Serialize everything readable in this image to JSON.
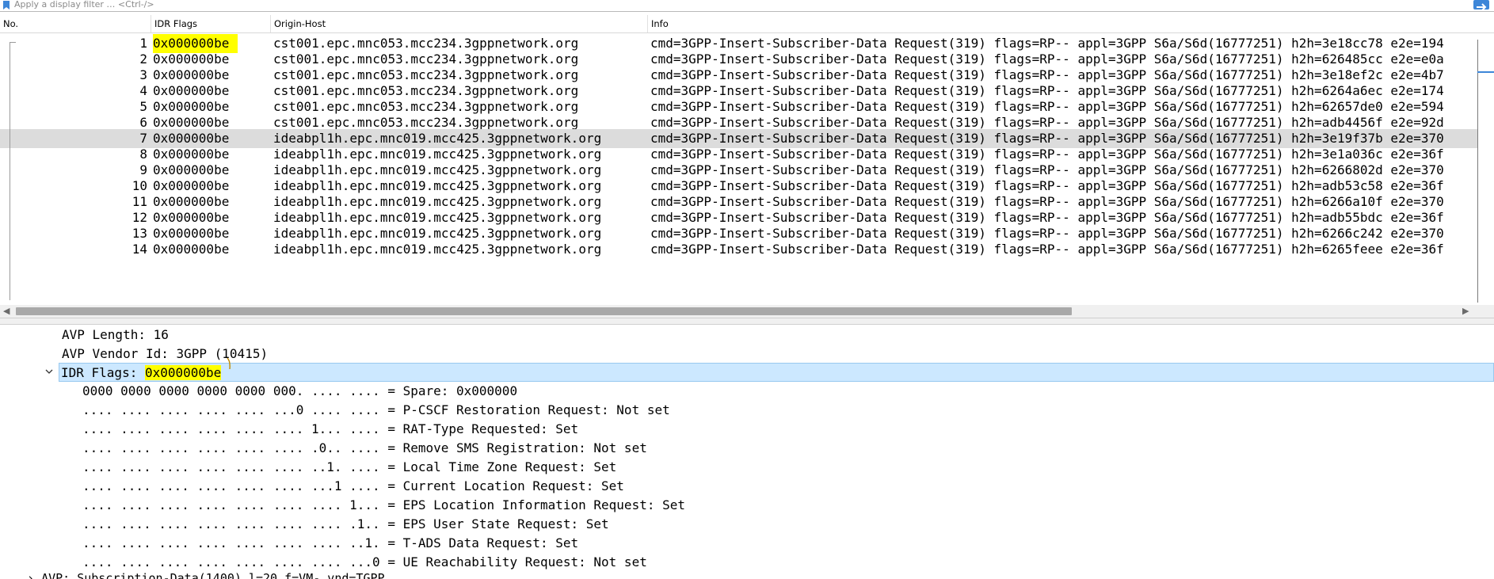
{
  "filter": {
    "placeholder": "Apply a display filter … <Ctrl-/>"
  },
  "columns": [
    "No.",
    "IDR Flags",
    "Origin-Host",
    "Info"
  ],
  "packets": [
    {
      "no": "1",
      "flags": "0x000000be",
      "host": "cst001.epc.mnc053.mcc234.3gppnetwork.org",
      "info": "cmd=3GPP-Insert-Subscriber-Data Request(319) flags=RP-- appl=3GPP S6a/S6d(16777251) h2h=3e18cc78 e2e=194"
    },
    {
      "no": "2",
      "flags": "0x000000be",
      "host": "cst001.epc.mnc053.mcc234.3gppnetwork.org",
      "info": "cmd=3GPP-Insert-Subscriber-Data Request(319) flags=RP-- appl=3GPP S6a/S6d(16777251) h2h=626485cc e2e=e0a"
    },
    {
      "no": "3",
      "flags": "0x000000be",
      "host": "cst001.epc.mnc053.mcc234.3gppnetwork.org",
      "info": "cmd=3GPP-Insert-Subscriber-Data Request(319) flags=RP-- appl=3GPP S6a/S6d(16777251) h2h=3e18ef2c e2e=4b7"
    },
    {
      "no": "4",
      "flags": "0x000000be",
      "host": "cst001.epc.mnc053.mcc234.3gppnetwork.org",
      "info": "cmd=3GPP-Insert-Subscriber-Data Request(319) flags=RP-- appl=3GPP S6a/S6d(16777251) h2h=6264a6ec e2e=174"
    },
    {
      "no": "5",
      "flags": "0x000000be",
      "host": "cst001.epc.mnc053.mcc234.3gppnetwork.org",
      "info": "cmd=3GPP-Insert-Subscriber-Data Request(319) flags=RP-- appl=3GPP S6a/S6d(16777251) h2h=62657de0 e2e=594"
    },
    {
      "no": "6",
      "flags": "0x000000be",
      "host": "cst001.epc.mnc053.mcc234.3gppnetwork.org",
      "info": "cmd=3GPP-Insert-Subscriber-Data Request(319) flags=RP-- appl=3GPP S6a/S6d(16777251) h2h=adb4456f e2e=92d"
    },
    {
      "no": "7",
      "flags": "0x000000be",
      "host": "ideabpl1h.epc.mnc019.mcc425.3gppnetwork.org",
      "info": "cmd=3GPP-Insert-Subscriber-Data Request(319) flags=RP-- appl=3GPP S6a/S6d(16777251) h2h=3e19f37b e2e=370"
    },
    {
      "no": "8",
      "flags": "0x000000be",
      "host": "ideabpl1h.epc.mnc019.mcc425.3gppnetwork.org",
      "info": "cmd=3GPP-Insert-Subscriber-Data Request(319) flags=RP-- appl=3GPP S6a/S6d(16777251) h2h=3e1a036c e2e=36f"
    },
    {
      "no": "9",
      "flags": "0x000000be",
      "host": "ideabpl1h.epc.mnc019.mcc425.3gppnetwork.org",
      "info": "cmd=3GPP-Insert-Subscriber-Data Request(319) flags=RP-- appl=3GPP S6a/S6d(16777251) h2h=6266802d e2e=370"
    },
    {
      "no": "10",
      "flags": "0x000000be",
      "host": "ideabpl1h.epc.mnc019.mcc425.3gppnetwork.org",
      "info": "cmd=3GPP-Insert-Subscriber-Data Request(319) flags=RP-- appl=3GPP S6a/S6d(16777251) h2h=adb53c58 e2e=36f"
    },
    {
      "no": "11",
      "flags": "0x000000be",
      "host": "ideabpl1h.epc.mnc019.mcc425.3gppnetwork.org",
      "info": "cmd=3GPP-Insert-Subscriber-Data Request(319) flags=RP-- appl=3GPP S6a/S6d(16777251) h2h=6266a10f e2e=370"
    },
    {
      "no": "12",
      "flags": "0x000000be",
      "host": "ideabpl1h.epc.mnc019.mcc425.3gppnetwork.org",
      "info": "cmd=3GPP-Insert-Subscriber-Data Request(319) flags=RP-- appl=3GPP S6a/S6d(16777251) h2h=adb55bdc e2e=36f"
    },
    {
      "no": "13",
      "flags": "0x000000be",
      "host": "ideabpl1h.epc.mnc019.mcc425.3gppnetwork.org",
      "info": "cmd=3GPP-Insert-Subscriber-Data Request(319) flags=RP-- appl=3GPP S6a/S6d(16777251) h2h=6266c242 e2e=370"
    },
    {
      "no": "14",
      "flags": "0x000000be",
      "host": "ideabpl1h.epc.mnc019.mcc425.3gppnetwork.org",
      "info": "cmd=3GPP-Insert-Subscriber-Data Request(319) flags=RP-- appl=3GPP S6a/S6d(16777251) h2h=6265feee e2e=36f"
    }
  ],
  "selected_packet": "7",
  "details": {
    "avp_length": "AVP Length: 16",
    "avp_vendor": "AVP Vendor Id: 3GPP (10415)",
    "idr_label": "IDR Flags: ",
    "idr_value": "0x000000be",
    "bits": [
      "0000 0000 0000 0000 0000 000. .... .... = Spare: 0x000000",
      ".... .... .... .... .... ...0 .... .... = P-CSCF Restoration Request: Not set",
      ".... .... .... .... .... .... 1... .... = RAT-Type Requested: Set",
      ".... .... .... .... .... .... .0.. .... = Remove SMS Registration: Not set",
      ".... .... .... .... .... .... ..1. .... = Local Time Zone Request: Set",
      ".... .... .... .... .... .... ...1 .... = Current Location Request: Set",
      ".... .... .... .... .... .... .... 1... = EPS Location Information Request: Set",
      ".... .... .... .... .... .... .... .1.. = EPS User State Request: Set",
      ".... .... .... .... .... .... .... ..1. = T-ADS Data Request: Set",
      ".... .... .... .... .... .... .... ...0 = UE Reachability Request: Not set"
    ],
    "next_avp": "AVP: Subscription-Data(1400) l=20 f=VM- vnd=TGPP"
  },
  "colors": {
    "highlight": "#ffff00",
    "selected_row": "#dcdcdc",
    "selected_detail": "#cce8ff",
    "accent": "#3d86d8"
  }
}
